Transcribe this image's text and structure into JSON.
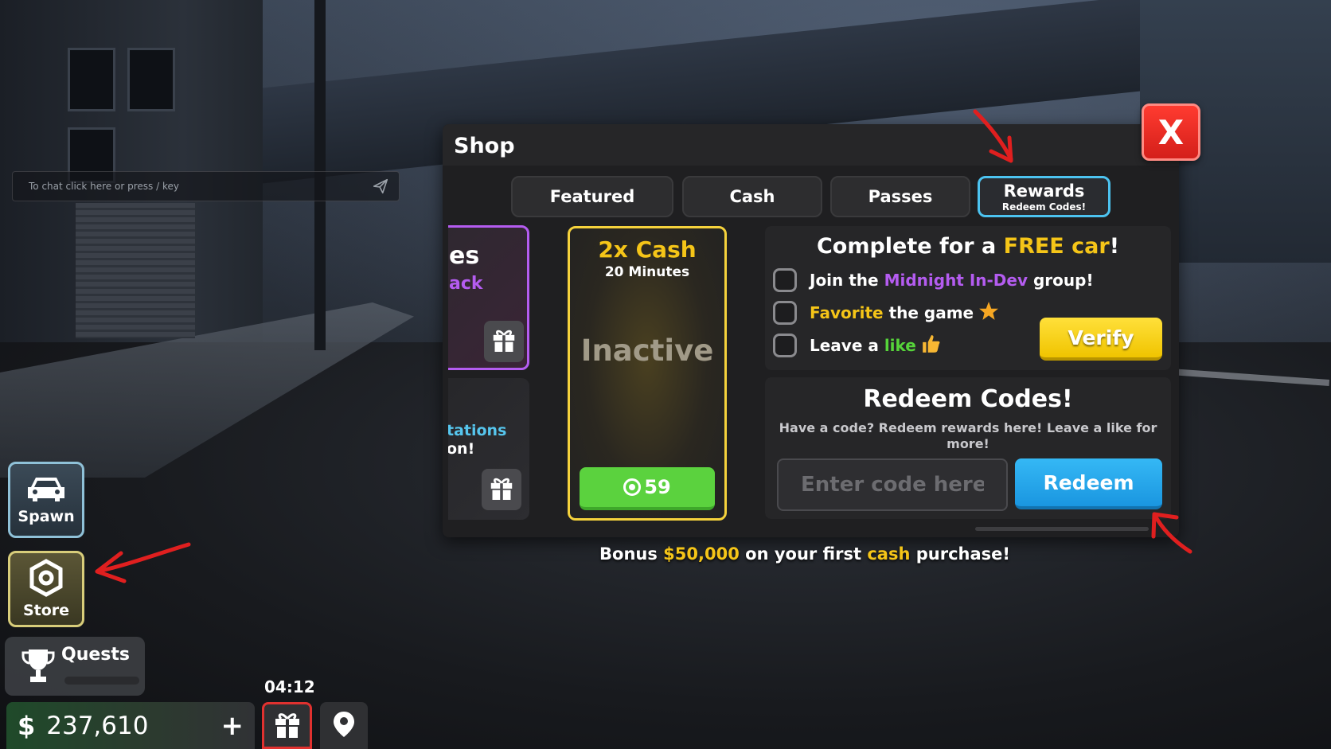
{
  "chat": {
    "placeholder": "To chat click here or press / key"
  },
  "hud": {
    "spawn_label": "Spawn",
    "store_label": "Store",
    "quests_label": "Quests",
    "timer": "04:12",
    "money_symbol": "$",
    "money_value": "237,610",
    "money_add": "+"
  },
  "shop": {
    "title": "Shop",
    "close_label": "X",
    "tabs": [
      {
        "label": "Featured",
        "sub": ""
      },
      {
        "label": "Cash",
        "sub": ""
      },
      {
        "label": "Passes",
        "sub": ""
      },
      {
        "label": "Rewards",
        "sub": "Redeem Codes!"
      }
    ],
    "active_tab": "Rewards",
    "partial_card_a": {
      "title": "es",
      "subtitle": "ack"
    },
    "partial_card_b": {
      "title": "tations",
      "subtitle": "on!"
    },
    "boost_card": {
      "title": "2x Cash",
      "duration": "20 Minutes",
      "status": "Inactive",
      "price": "59"
    },
    "free_car": {
      "title_prefix": "Complete for a ",
      "title_highlight": "FREE car",
      "title_suffix": "!",
      "tasks": [
        {
          "pre": "Join the ",
          "highlight": "Midnight In-Dev",
          "post": " group!",
          "checked": false
        },
        {
          "pre": "",
          "highlight": "Favorite",
          "post": " the game",
          "icon": "star-icon",
          "checked": false
        },
        {
          "pre": "Leave a ",
          "highlight": "like",
          "post": "",
          "icon": "thumbs-up-icon",
          "checked": false
        }
      ],
      "verify_label": "Verify"
    },
    "redeem": {
      "title": "Redeem Codes!",
      "description": "Have a code? Redeem rewards here! Leave a like for more!",
      "input_placeholder": "Enter code here",
      "input_value": "",
      "button_label": "Redeem"
    },
    "bonus": {
      "pre": "Bonus ",
      "amount": "$50,000",
      "mid": " on your first ",
      "word": "cash",
      "post": " purchase!"
    }
  },
  "colors": {
    "accent_yellow": "#f5c518",
    "accent_purple": "#b45cf0",
    "accent_blue": "#35b8f5",
    "accent_green": "#5bd23e",
    "close_red": "#ff3b30",
    "annotation_red": "#e01f1f"
  }
}
